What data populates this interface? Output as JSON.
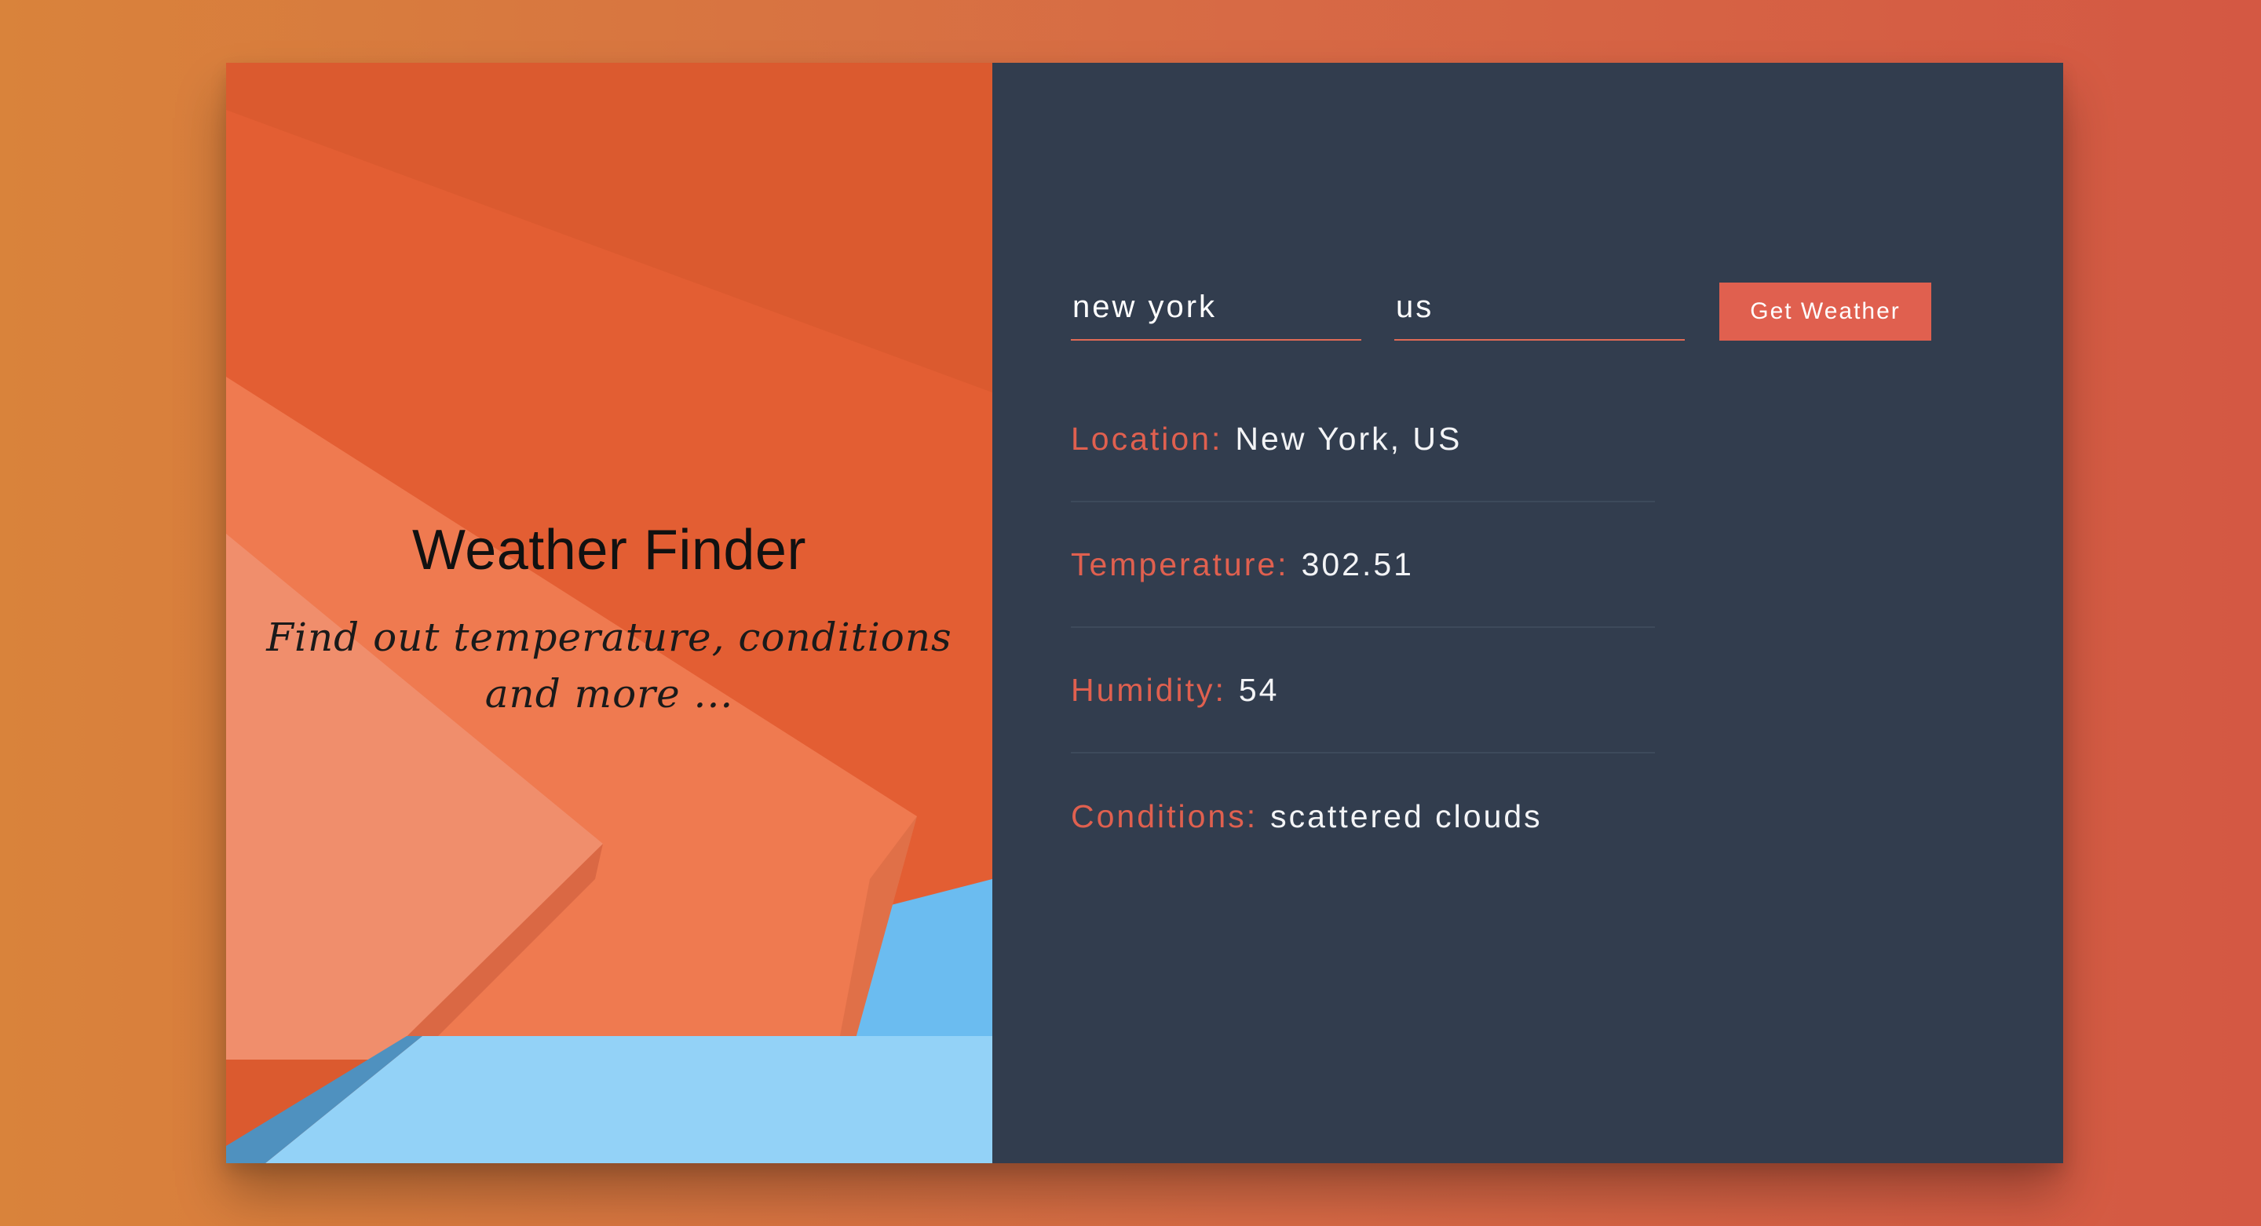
{
  "hero": {
    "title": "Weather Finder",
    "subtitle": "Find out temperature, conditions and more ..."
  },
  "form": {
    "city_value": "new york",
    "country_value": "us",
    "button_label": "Get Weather"
  },
  "results": [
    {
      "label": "Location:",
      "value": "New York, US"
    },
    {
      "label": "Temperature:",
      "value": "302.51"
    },
    {
      "label": "Humidity:",
      "value": "54"
    },
    {
      "label": "Conditions:",
      "value": "scattered clouds"
    }
  ],
  "colors": {
    "accent": "#e0604f",
    "panel": "#323d4e",
    "background_start": "#d9833b",
    "background_end": "#d45843"
  }
}
